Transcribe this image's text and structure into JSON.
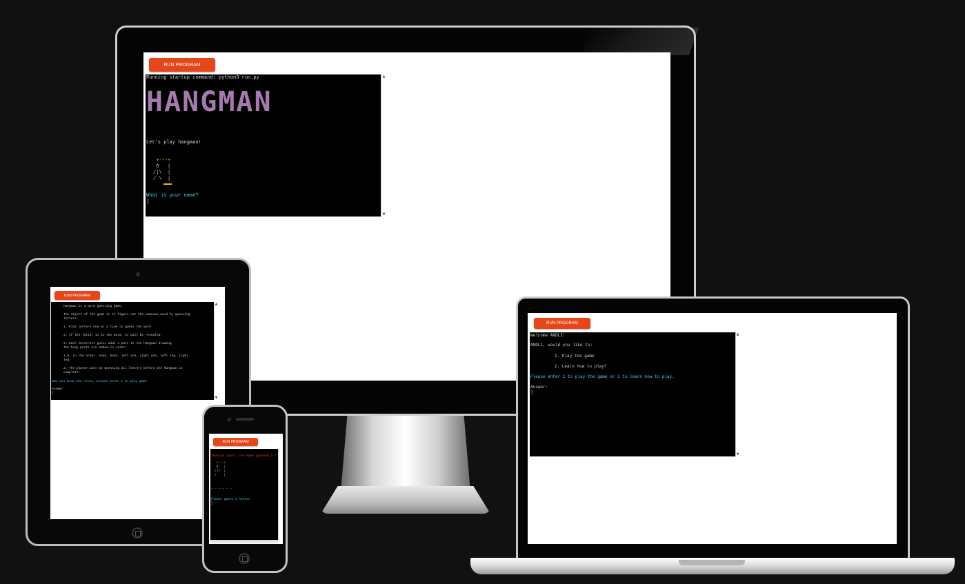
{
  "run_button_label": "RUN PROGRAM",
  "monitor": {
    "startup_line": "Running startup command: python3 run.py",
    "logo_text": "HANGMAN",
    "greeting": "Let's play hangman!",
    "gallows": [
      " +---+",
      " O   |",
      "/|\\  |",
      "/ \\  |"
    ],
    "prompt": "What is your name?",
    "cursor": "]"
  },
  "tablet": {
    "lines": [
      "Hangman is a word guessing game.",
      "The object of the game is to figure out the unknown word by guessing",
      "letters.",
      "1. Pick letters one at a time to guess the word.",
      "2. If the letter is in the word, it will be revealed.",
      "3. Each incorrect guess adds a part to the hangman drawing.",
      "The body parts are added in order:",
      "1.0. in the order: head, body, left arm, right arm, left leg, right",
      "leg.",
      "2. The player wins by guessing all letters before the hangman is",
      "complete."
    ],
    "ready": "Now you know the rules, please enter 1 to play game.",
    "answer": "Answer:",
    "cursor": "]"
  },
  "phone": {
    "error": "Invalid input: You have guessed 2 t",
    "gallows": [
      " +---+",
      " O   |",
      "/|\\  |",
      "/    |"
    ],
    "word": "_ _ _ _ _ _",
    "prompt": "Please guess a letter",
    "cursor": "]"
  },
  "laptop": {
    "welcome": "Welcome ANDLI!",
    "question": "ANDLI, would you like to:",
    "option1": "1. Play the game",
    "option2": "2. Learn how to play?",
    "instruction": "Please enter 1 to play the game or 2 to learn how to play.",
    "answer": "Answer:",
    "cursor": "]"
  }
}
